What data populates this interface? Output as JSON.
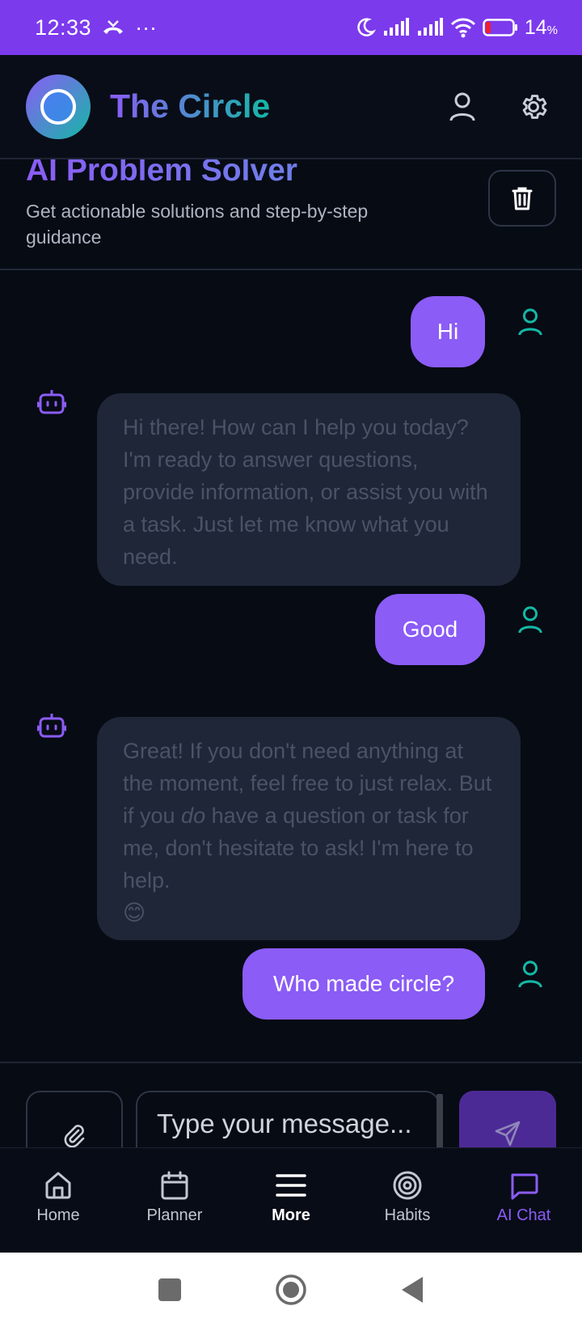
{
  "status_bar": {
    "time": "12:33",
    "more": "···",
    "battery_pct": "14",
    "battery_unit": "%"
  },
  "header": {
    "app_title": "The Circle"
  },
  "chat_header": {
    "title": "AI Problem Solver",
    "subtitle": "Get actionable solutions and step-by-step guidance"
  },
  "messages": [
    {
      "role": "user",
      "text": "Hi"
    },
    {
      "role": "assistant",
      "text": "Hi there! How can I help you today? I'm ready to answer questions, provide information, or assist you with a task. Just let me know what you need."
    },
    {
      "role": "user",
      "text": "Good"
    },
    {
      "role": "assistant",
      "text_before": "Great! If you don't need anything at the moment, feel free to just relax. But if you ",
      "text_em": "do",
      "text_after": " have a question or task for me, don't hesitate to ask! I'm here to help.",
      "emoji": "😊"
    },
    {
      "role": "user",
      "text": "Who made circle?"
    }
  ],
  "composer": {
    "placeholder": "Type your message..."
  },
  "bottom_nav": {
    "items": [
      {
        "label": "Home",
        "icon": "home-icon"
      },
      {
        "label": "Planner",
        "icon": "calendar-icon"
      },
      {
        "label": "More",
        "icon": "menu-icon"
      },
      {
        "label": "Habits",
        "icon": "target-icon"
      },
      {
        "label": "AI Chat",
        "icon": "chat-icon",
        "active": true
      }
    ]
  },
  "colors": {
    "accent": "#8b5cf6",
    "status_bar": "#7c3aed",
    "teal": "#14b8a6",
    "background": "#070b14",
    "ai_bubble": "#1e2637"
  }
}
